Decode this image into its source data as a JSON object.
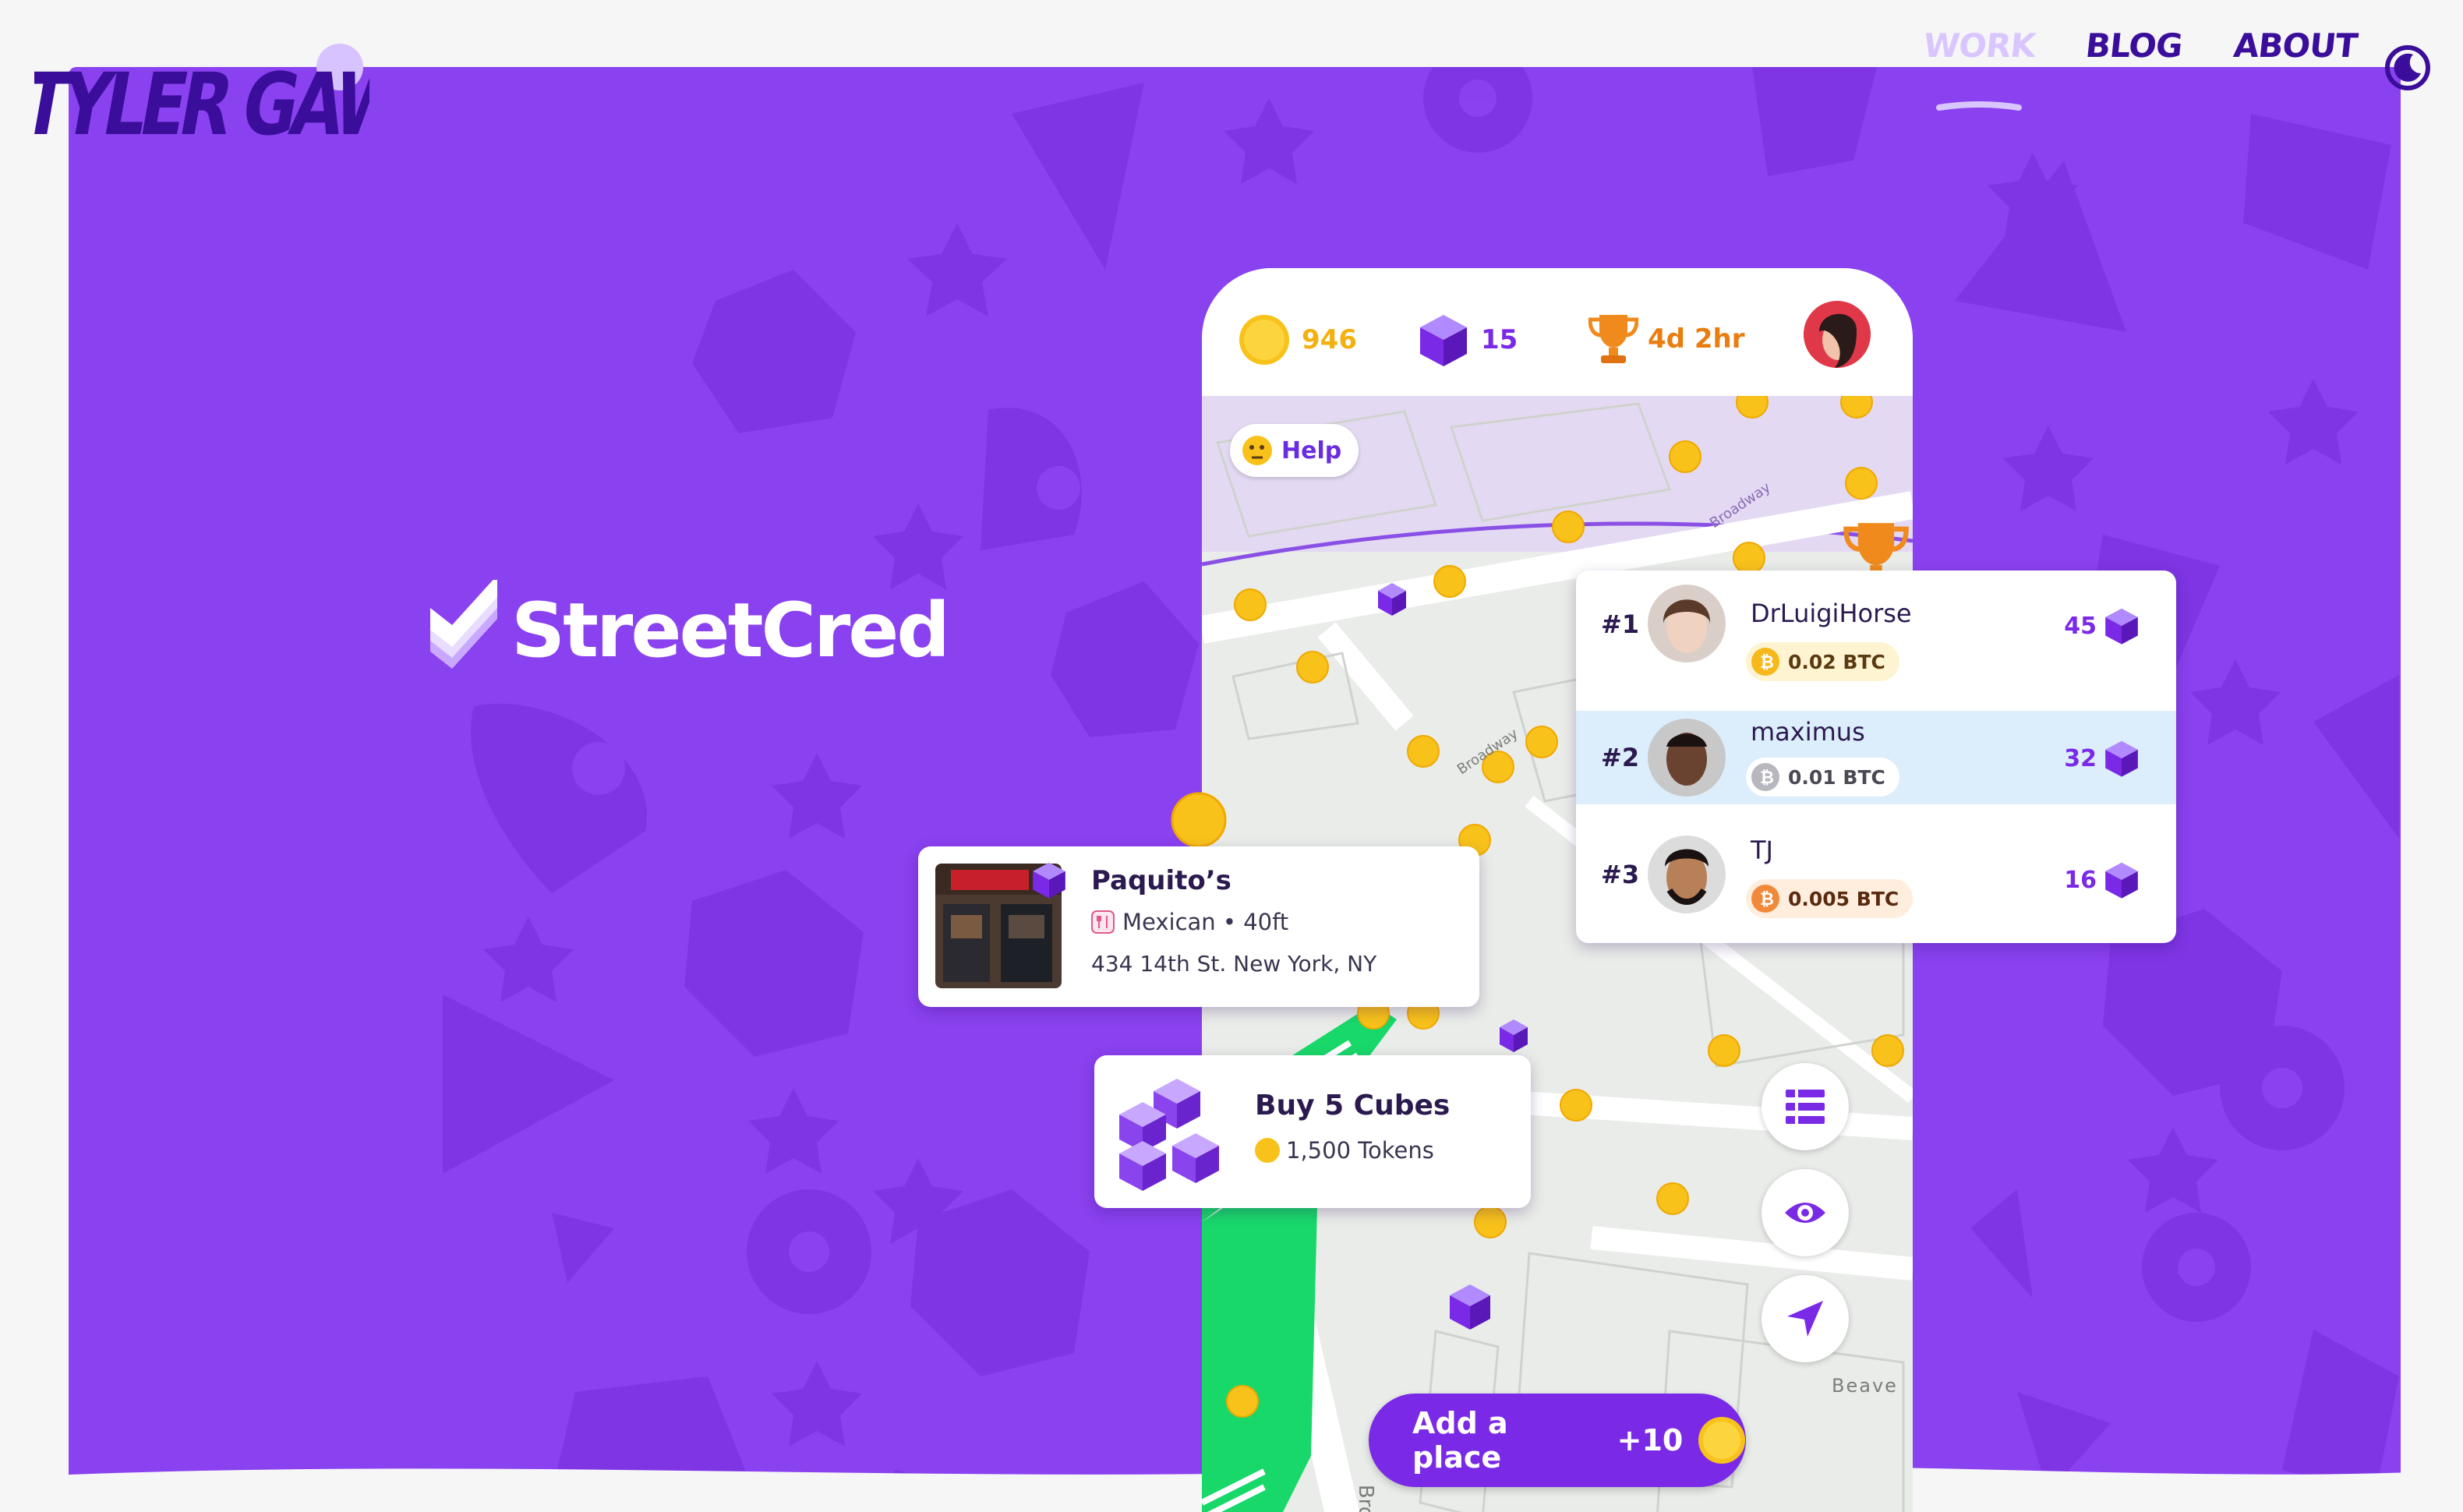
{
  "header": {
    "logo_text": "TYLER GAW",
    "nav": [
      {
        "label": "WORK",
        "active": true
      },
      {
        "label": "BLOG",
        "active": false
      },
      {
        "label": "ABOUT",
        "active": false
      }
    ],
    "theme_toggle_icon": "moon-icon"
  },
  "hero": {
    "brand_name": "StreetCred",
    "brand_icon": "check-icon",
    "accent_color": "#8a41ef"
  },
  "phone": {
    "stats": {
      "tokens": "946",
      "cubes": "15",
      "time_left": "4d 2hr"
    },
    "help_label": "Help",
    "street_labels": [
      "Broadway",
      "Broadway",
      "Beave",
      "Broad"
    ],
    "add_place": {
      "label": "Add a place",
      "bonus": "+10"
    }
  },
  "leaderboard": [
    {
      "rank": "#1",
      "name": "DrLuigiHorse",
      "btc": "0.02 BTC",
      "cubes": "45"
    },
    {
      "rank": "#2",
      "name": "maximus",
      "btc": "0.01 BTC",
      "cubes": "32"
    },
    {
      "rank": "#3",
      "name": "TJ",
      "btc": "0.005 BTC",
      "cubes": "16"
    }
  ],
  "place_card": {
    "title": "Paquito’s",
    "category": "Mexican • 40ft",
    "address": "434 14th St. New York, NY"
  },
  "buy_card": {
    "title": "Buy 5 Cubes",
    "price": "1,500 Tokens"
  }
}
